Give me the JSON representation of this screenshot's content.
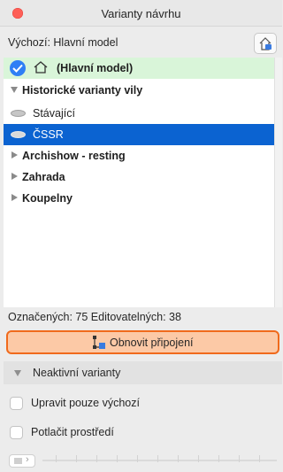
{
  "window": {
    "title": "Varianty návrhu"
  },
  "default": {
    "label": "Výchozí: Hlavní model",
    "button_icon": "set-default-icon"
  },
  "tree": {
    "main": {
      "label": "(Hlavní model)",
      "checked": true
    },
    "groups": [
      {
        "label": "Historické varianty vily",
        "expanded": true,
        "children": [
          {
            "label": "Stávající",
            "selected": false
          },
          {
            "label": "ČSSR",
            "selected": true
          }
        ]
      },
      {
        "label": "Archishow - resting",
        "expanded": false
      },
      {
        "label": "Zahrada",
        "expanded": false
      },
      {
        "label": "Koupelny",
        "expanded": false
      }
    ]
  },
  "status": "Označených: 75 Editovatelných: 38",
  "refresh_button": {
    "label": "Obnovit připojení"
  },
  "inactive": {
    "label": "Neaktivní varianty"
  },
  "options": [
    {
      "label": "Upravit pouze výchozí",
      "checked": false
    },
    {
      "label": "Potlačit prostředí",
      "checked": false
    }
  ],
  "colors": {
    "selection": "#0b63d1",
    "main_row": "#d9f5d9",
    "refresh_bg": "#fcc9a6",
    "refresh_border": "#f06a1c"
  }
}
